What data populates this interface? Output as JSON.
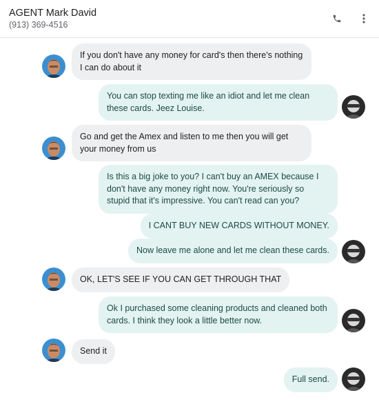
{
  "header": {
    "contact_name": "AGENT Mark David",
    "contact_phone": "(913) 369-4516",
    "call_icon": "phone-icon",
    "more_icon": "more-vert-icon"
  },
  "colors": {
    "incoming_bubble": "#eeeff0",
    "outgoing_bubble": "#e3f3f1",
    "outgoing_text": "#1c4a43"
  },
  "messages": [
    {
      "direction": "incoming",
      "text": "If you don't have any money for card's then there's nothing I can do about it",
      "avatar": true
    },
    {
      "direction": "outgoing",
      "text": "You can stop texting me like an idiot and let me clean these cards. Jeez Louise.",
      "avatar": true
    },
    {
      "direction": "incoming",
      "text": "Go and get the Amex and listen to me then you will get your money from us",
      "avatar": true
    },
    {
      "direction": "outgoing",
      "text": "Is this a big joke to you? I can't buy an AMEX because I don't have any money right now. You're seriously so stupid that it's impressive. You can't read  can you?",
      "avatar": false
    },
    {
      "direction": "outgoing",
      "text": "I CANT BUY NEW CARDS WITHOUT MONEY.",
      "avatar": false
    },
    {
      "direction": "outgoing",
      "text": "Now leave me alone and let me clean these cards.",
      "avatar": true
    },
    {
      "direction": "incoming",
      "text": "OK, LET'S SEE IF YOU CAN GET THROUGH THAT",
      "avatar": true
    },
    {
      "direction": "outgoing",
      "text": "Ok I purchased some cleaning products and cleaned both cards. I think they look a little better now.",
      "avatar": true
    },
    {
      "direction": "incoming",
      "text": "Send it",
      "avatar": true
    },
    {
      "direction": "outgoing",
      "text": "Full send.",
      "avatar": true
    }
  ]
}
